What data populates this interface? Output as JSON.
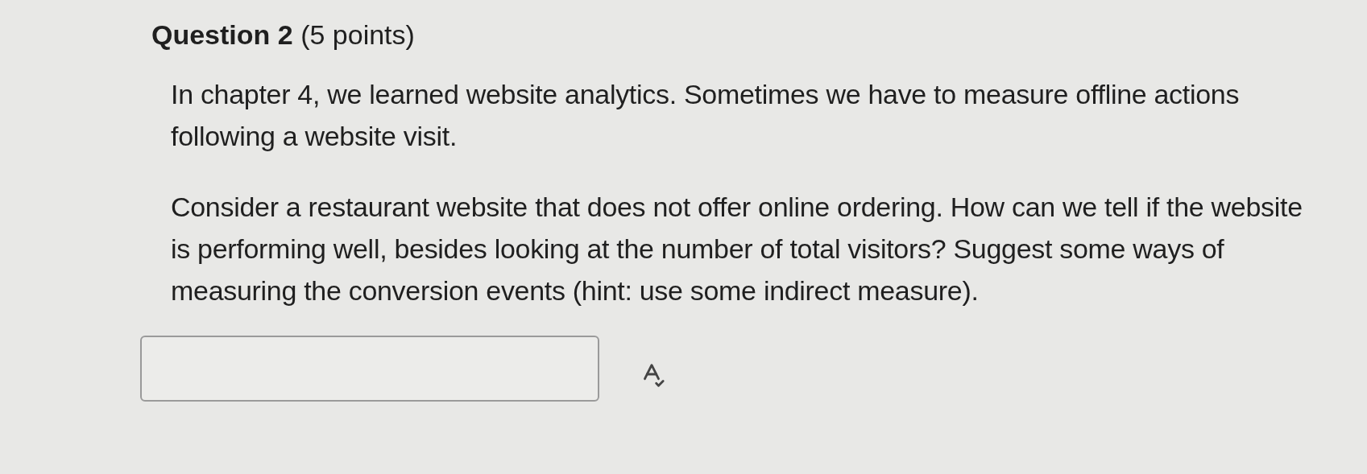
{
  "question": {
    "title": "**Question 2** (5 points)",
    "paragraphs": [
      "In chapter 4, we learned website analytics.  Sometimes we have to measure offline actions following a website visit.",
      "Consider a restaurant website that does not offer online ordering. How can we tell if the website is performing well, besides looking at the number of total visitors? Suggest some ways of measuring the conversion events (hint: use some indirect measure)."
    ]
  }
}
